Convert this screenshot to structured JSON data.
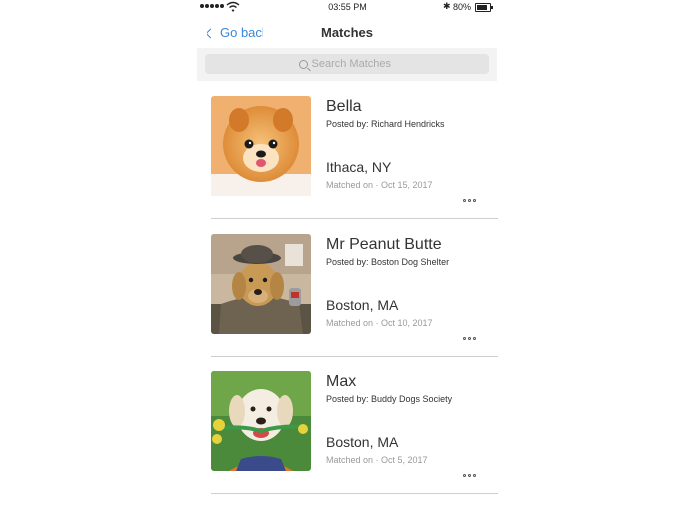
{
  "status_bar": {
    "time": "03:55 PM",
    "battery": "80%"
  },
  "nav": {
    "back_label": "Go back",
    "title": "Matches"
  },
  "search": {
    "placeholder": "Search Matches"
  },
  "matches": [
    {
      "name": "Bella",
      "posted_by": "Posted by: Richard Hendricks",
      "location": "Ithaca, NY",
      "matched_on": "Matched on · Oct 15, 2017",
      "photo": "pomeranian-photo"
    },
    {
      "name": "Mr Peanut Butter",
      "posted_by": "Posted by: Boston Dog Shelter",
      "location": "Boston, MA",
      "matched_on": "Matched on · Oct 10, 2017",
      "photo": "labrador-in-hat-photo"
    },
    {
      "name": "Max",
      "posted_by": "Posted by: Buddy Dogs Society",
      "location": "Boston, MA",
      "matched_on": "Matched on · Oct 5, 2017",
      "photo": "puppy-with-toy-photo"
    }
  ],
  "colors": {
    "accent": "#3b87d9",
    "separator": "#cfcfcf",
    "search_bg": "#e4e4e4"
  }
}
